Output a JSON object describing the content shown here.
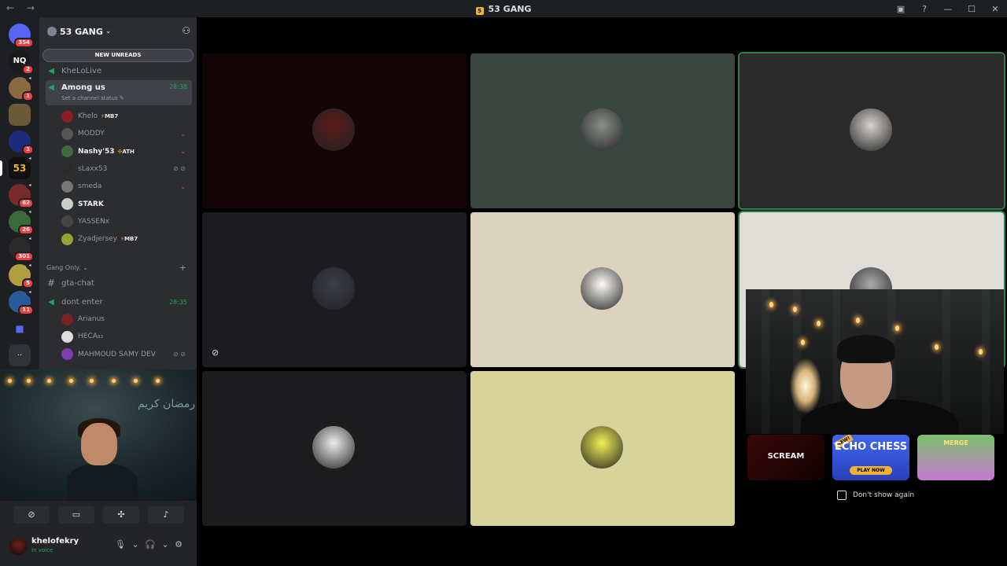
{
  "window": {
    "title": "53 GANG",
    "nav_arrows": "← →",
    "controls": [
      "▣",
      "?",
      "—",
      "☐",
      "✕"
    ]
  },
  "servers": [
    {
      "icon": "discord-home-icon",
      "badge": "354"
    },
    {
      "icon": "server-nq-icon",
      "label": "NQ",
      "badge": "2"
    },
    {
      "icon": "server-avatar-icon",
      "badge": "1"
    },
    {
      "icon": "server-avatar-icon"
    },
    {
      "icon": "server-c-icon",
      "badge": "1"
    },
    {
      "icon": "server-53-icon",
      "label": "53"
    },
    {
      "icon": "server-avatar-icon",
      "badge": "62"
    },
    {
      "icon": "server-avatar-icon",
      "badge": "26"
    },
    {
      "icon": "server-avatar-icon",
      "badge": "301"
    },
    {
      "icon": "server-avatar-icon",
      "badge": "5"
    },
    {
      "icon": "server-avatar-icon",
      "badge": "11"
    },
    {
      "icon": "folder-icon"
    },
    {
      "icon": "more-icon",
      "label": ".."
    }
  ],
  "guild": {
    "name": "53 GANG",
    "caret": "⌄",
    "new_unreads": "NEW UNREADS"
  },
  "channels": {
    "khelolive": {
      "name": "KheLoLive"
    },
    "among_us": {
      "name": "Among us",
      "timer": "28:38",
      "status": "Set a channel status ✎"
    },
    "among_us_users": [
      {
        "name": "Khelo",
        "tag_icon": "⚡",
        "tag": "MB7",
        "color": "#8a1f1f"
      },
      {
        "name": "MODDY",
        "ind": "⌄",
        "color": "#555"
      },
      {
        "name": "Nashy'53",
        "tag_icon": "✣",
        "tag": "ATH",
        "ind": "⌄",
        "color": "#3d6b3d",
        "bright": true
      },
      {
        "name": "sLaxx53",
        "ind": "⊘ ⊘",
        "gray": true,
        "color": "#2b2b2b"
      },
      {
        "name": "smeda",
        "ind": "⌄",
        "color": "#777"
      },
      {
        "name": "STARK",
        "color": "#c9cfc9",
        "bright": true
      },
      {
        "name": "YASSENx",
        "color": "#444"
      },
      {
        "name": "Zyadjersey",
        "tag_icon": "⚡",
        "tag": "MB7",
        "color": "#9aa03a"
      }
    ],
    "category": {
      "name": "Gang Only.",
      "caret": "⌄",
      "plus": "+"
    },
    "gta_chat": {
      "name": "gta-chat"
    },
    "dont_enter": {
      "name": "dont enter",
      "timer": "28:35"
    },
    "dont_enter_users": [
      {
        "name": "Arianus",
        "color": "#7a2222"
      },
      {
        "name": "HECA₈₃",
        "color": "#ddd"
      },
      {
        "name": "MAHMOUD SAMY DEV",
        "ind": "⊘ ⊘",
        "gray": true,
        "color": "#7a3fb0"
      }
    ]
  },
  "webcam_overlay": {
    "arabic_text": "رمضان كريم"
  },
  "user_panel": {
    "controls": [
      {
        "icon": "camera-off-icon",
        "glyph": "⊘"
      },
      {
        "icon": "screen-share-icon",
        "glyph": "▭"
      },
      {
        "icon": "activities-icon",
        "glyph": "✣"
      },
      {
        "icon": "soundboard-icon",
        "glyph": "♪"
      }
    ],
    "username": "khelofekry",
    "status": "In voice",
    "mic": "🎙 ⌄ 🎧 ⌄ ⚙"
  },
  "tiles": [
    {
      "bg": "#140606",
      "avatar": "#5a1a1a"
    },
    {
      "bg": "#3a4640",
      "avatar": "#8a8f8a"
    },
    {
      "bg": "#2a2a2a",
      "avatar": "#d8d2cc",
      "selected": true
    },
    {
      "bg": "#1c1c20",
      "avatar": "#3b3e48",
      "muted": true
    },
    {
      "bg": "#dcd3bf",
      "avatar": "#fefcf6"
    },
    {
      "bg": "#e0ddd8",
      "avatar": "#aaaaaa",
      "selected": true
    },
    {
      "bg": "#1c1c1e",
      "avatar": "#eeeeee"
    },
    {
      "bg": "#d8d39a",
      "avatar": "#f3ef56"
    }
  ],
  "ads": [
    {
      "title": "SCREAM",
      "bg": "#2a0404"
    },
    {
      "title": "ECHO CHESS",
      "new": "NEW!",
      "cta": "PLAY NOW",
      "bg": "#3a5ee8"
    },
    {
      "title": "MERGE",
      "bg": "#5aa24a"
    }
  ],
  "dont_show_again": "Don't show again"
}
